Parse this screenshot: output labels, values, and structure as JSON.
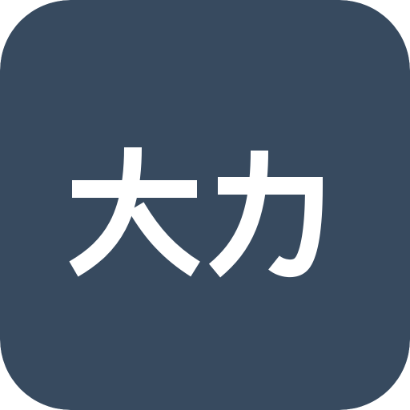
{
  "app_icon": {
    "label": "大力",
    "background_color": "#374A5F",
    "text_color": "#FFFFFF"
  }
}
